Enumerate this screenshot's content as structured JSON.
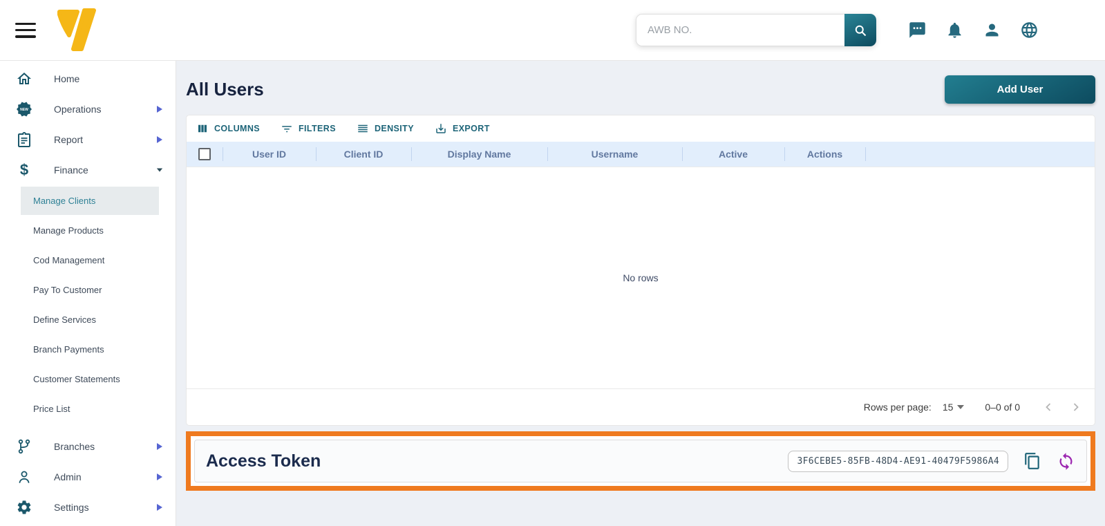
{
  "header": {
    "search": {
      "placeholder": "AWB NO."
    },
    "icons": [
      "chat-icon",
      "notifications-icon",
      "profile-icon",
      "language-icon"
    ]
  },
  "sidebar": {
    "items": [
      {
        "label": "Home",
        "icon": "home-icon",
        "expandable": false
      },
      {
        "label": "Operations",
        "icon": "new-badge-icon",
        "expandable": true
      },
      {
        "label": "Report",
        "icon": "report-icon",
        "expandable": true
      },
      {
        "label": "Finance",
        "icon": "finance-icon",
        "expandable": true,
        "expanded": true
      },
      {
        "label": "Manage Clients",
        "sub": true,
        "selected": true
      },
      {
        "label": "Manage Products",
        "sub": true
      },
      {
        "label": "Cod Management",
        "sub": true
      },
      {
        "label": "Pay To Customer",
        "sub": true
      },
      {
        "label": "Define Services",
        "sub": true
      },
      {
        "label": "Branch Payments",
        "sub": true
      },
      {
        "label": "Customer Statements",
        "sub": true
      },
      {
        "label": "Price List",
        "sub": true
      },
      {
        "label": "Branches",
        "icon": "branches-icon",
        "expandable": true
      },
      {
        "label": "Admin",
        "icon": "admin-icon",
        "expandable": true
      },
      {
        "label": "Settings",
        "icon": "settings-icon",
        "expandable": true
      }
    ]
  },
  "main": {
    "title": "All Users",
    "add_user_label": "Add User",
    "table": {
      "toolbar": [
        {
          "label": "COLUMNS",
          "icon": "columns-icon"
        },
        {
          "label": "FILTERS",
          "icon": "filters-icon"
        },
        {
          "label": "DENSITY",
          "icon": "density-icon"
        },
        {
          "label": "EXPORT",
          "icon": "export-icon"
        }
      ],
      "columns": [
        "User ID",
        "Client ID",
        "Display Name",
        "Username",
        "Active",
        "Actions"
      ],
      "empty_text": "No rows",
      "pagination": {
        "rows_per_page_label": "Rows per page:",
        "rows_per_page": "15",
        "range": "0–0 of 0"
      }
    },
    "access_token": {
      "title": "Access Token",
      "value": "3F6CEBE5-85FB-48D4-AE91-40479F5986A4"
    }
  },
  "colors": {
    "accent_teal": "#1d6478",
    "accent_orange": "#ef7a1f",
    "brand_yellow": "#f5b717",
    "refresh_purple": "#9c27b0",
    "arrow_blue": "#5665d2",
    "table_header_bg": "#e2eefc"
  }
}
